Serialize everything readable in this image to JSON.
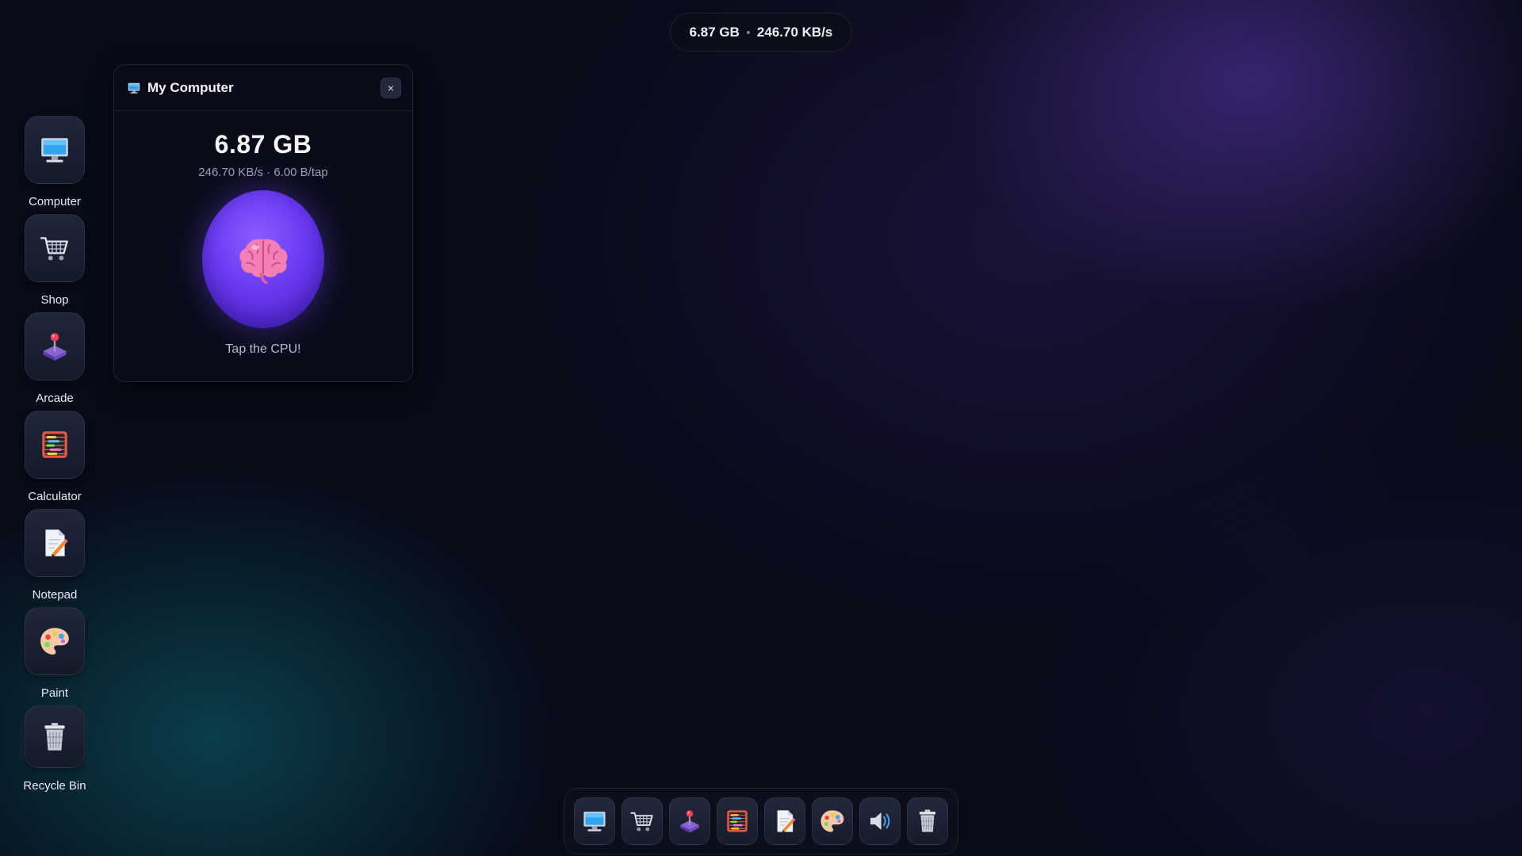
{
  "status_bar": {
    "storage": "6.87 GB",
    "rate": "246.70 KB/s"
  },
  "desktop": {
    "items": [
      {
        "label": "Computer",
        "icon": "monitor-icon"
      },
      {
        "label": "Shop",
        "icon": "cart-icon"
      },
      {
        "label": "Arcade",
        "icon": "joystick-icon"
      },
      {
        "label": "Calculator",
        "icon": "abacus-icon"
      },
      {
        "label": "Notepad",
        "icon": "notepad-icon"
      },
      {
        "label": "Paint",
        "icon": "palette-icon"
      },
      {
        "label": "Recycle Bin",
        "icon": "trash-icon"
      }
    ]
  },
  "window": {
    "title": "My Computer",
    "close_label": "×",
    "storage": "6.87 GB",
    "rates": "246.70 KB/s · 6.00 B/tap",
    "tap_hint": "Tap the CPU!",
    "orb_icon": "brain-icon"
  },
  "taskbar": {
    "items": [
      "monitor-icon",
      "cart-icon",
      "joystick-icon",
      "abacus-icon",
      "notepad-icon",
      "palette-icon",
      "speaker-icon",
      "trash-icon"
    ]
  },
  "colors": {
    "accent": "#6a3af2",
    "brain": "#f26aa8",
    "background": "#080b18"
  }
}
